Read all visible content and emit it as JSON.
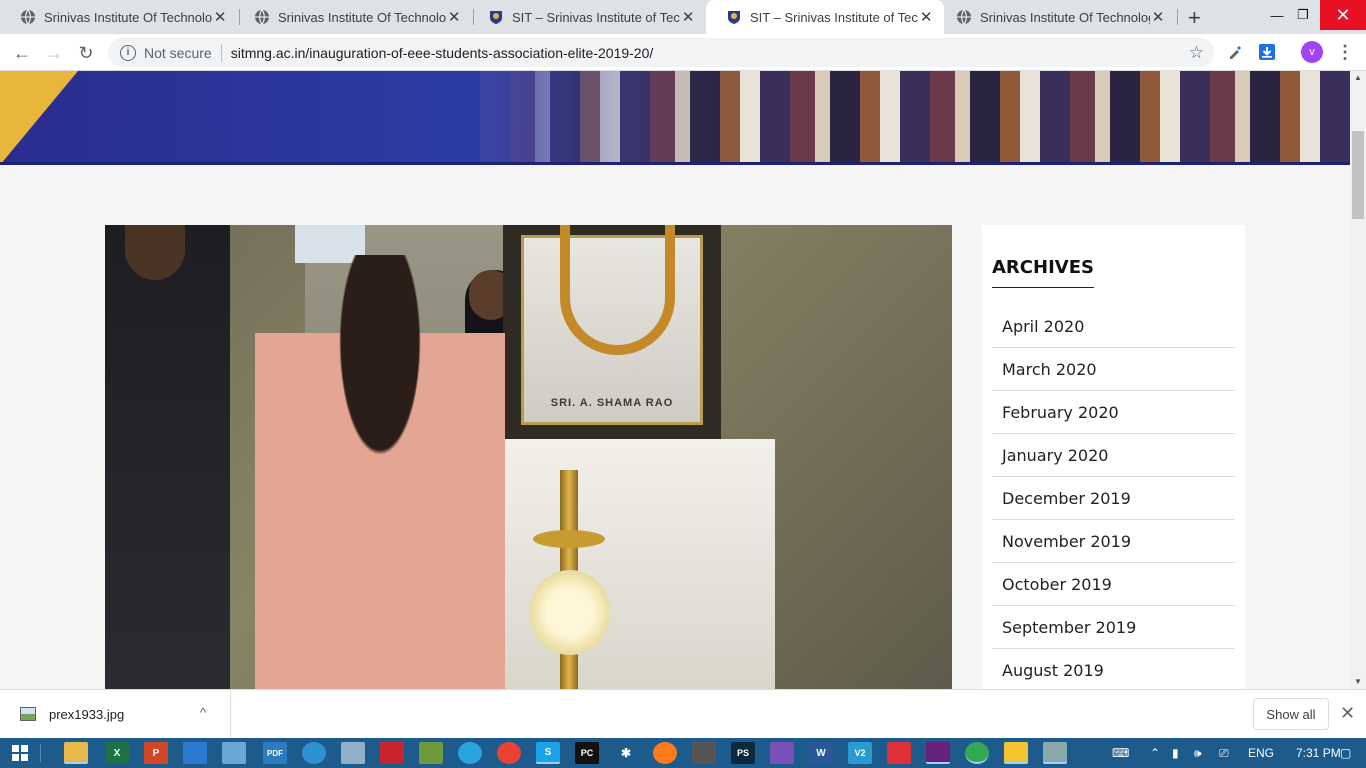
{
  "browser": {
    "tabs": [
      {
        "title": "Srinivas Institute Of Technology",
        "favicon": "globe-icon",
        "active": false
      },
      {
        "title": "Srinivas Institute Of Technology",
        "favicon": "globe-icon",
        "active": false
      },
      {
        "title": "SIT – Srinivas Institute of Techno",
        "favicon": "sit-crest-icon",
        "active": false
      },
      {
        "title": "SIT – Srinivas Institute of Techno",
        "favicon": "sit-crest-icon",
        "active": true
      },
      {
        "title": "Srinivas Institute Of Technology",
        "favicon": "globe-icon",
        "active": false
      }
    ],
    "close_glyph": "✕",
    "new_tab_glyph": "+",
    "window_controls": {
      "minimize": "—",
      "restore": "❐",
      "close": "✕"
    },
    "toolbar": {
      "back": "←",
      "forward": "→",
      "reload": "↻",
      "security_label": "Not secure",
      "url": "sitmng.ac.in/inauguration-of-eee-students-association-elite-2019-20/",
      "star": "☆",
      "profile_initial": "v",
      "menu": "⋮"
    }
  },
  "page": {
    "photo_caption": "SRI. A. SHAMA RAO",
    "sidebar": {
      "heading": "ARCHIVES",
      "items": [
        "April 2020",
        "March 2020",
        "February 2020",
        "January 2020",
        "December 2019",
        "November 2019",
        "October 2019",
        "September 2019",
        "August 2019"
      ]
    }
  },
  "download_bar": {
    "filename": "prex1933.jpg",
    "chevron": "^",
    "show_all": "Show all",
    "close": "✕"
  },
  "taskbar": {
    "language": "ENG",
    "time": "7:31 PM",
    "apps": [
      "file-explorer",
      "excel",
      "powerpoint",
      "vscode",
      "notepad",
      "pdf",
      "kodi",
      "photos",
      "acrobat",
      "tool",
      "sync",
      "chrome",
      "skype",
      "pycharm",
      "bluetooth",
      "firefox",
      "calc",
      "photoshop",
      "visual-studio",
      "word",
      "v2",
      "anydesk",
      "vs",
      "chrome2",
      "sticky",
      "paint"
    ]
  },
  "colors": {
    "banner_blue": "#2c3ea8",
    "banner_gold": "#e8b63a",
    "close_red": "#e81123",
    "taskbar_blue": "#1d5b8c",
    "avatar_purple": "#a142f4"
  }
}
